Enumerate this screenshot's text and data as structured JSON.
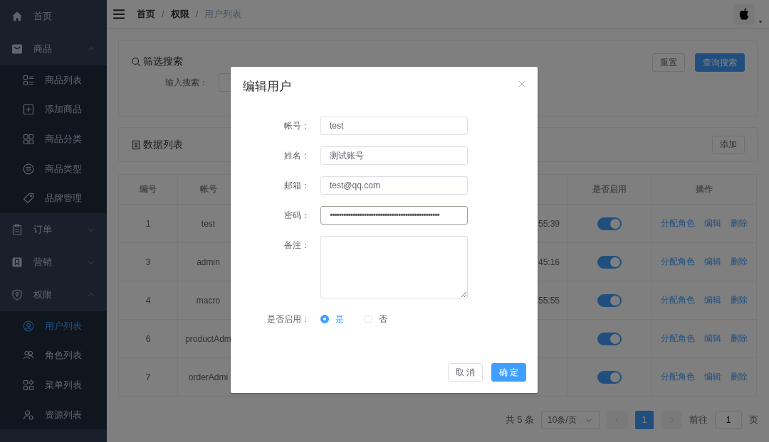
{
  "sidebar": {
    "groups": [
      {
        "label": "首页"
      },
      {
        "label": "商品",
        "expanded": true,
        "children": [
          {
            "label": "商品列表",
            "selected": false
          },
          {
            "label": "添加商品",
            "selected": false
          },
          {
            "label": "商品分类",
            "selected": false
          },
          {
            "label": "商品类型",
            "selected": false
          },
          {
            "label": "品牌管理",
            "selected": false
          }
        ]
      },
      {
        "label": "订单",
        "expanded": false
      },
      {
        "label": "营销",
        "expanded": false
      },
      {
        "label": "权限",
        "expanded": true,
        "children": [
          {
            "label": "用户列表",
            "selected": true
          },
          {
            "label": "角色列表",
            "selected": false
          },
          {
            "label": "菜单列表",
            "selected": false
          },
          {
            "label": "资源列表",
            "selected": false
          }
        ]
      }
    ]
  },
  "breadcrumb": [
    {
      "label": "首页",
      "kind": "link"
    },
    {
      "label": "/",
      "kind": "separator"
    },
    {
      "label": "权限",
      "kind": "link"
    },
    {
      "label": "/",
      "kind": "separator"
    },
    {
      "label": "用户列表",
      "kind": "current"
    }
  ],
  "search_card": {
    "title": "筛选搜索",
    "reset_button": "重置",
    "search_button": "查询搜索",
    "input_label": "输入搜索："
  },
  "list_card": {
    "title": "数据列表",
    "add_button": "添加"
  },
  "table": {
    "columns": [
      "编号",
      "帐号",
      "是否启用",
      "操作"
    ],
    "rows": [
      {
        "id": "1",
        "account": "test",
        "column_3": "55:39",
        "enabled": true,
        "actions": [
          "分配角色",
          "编辑",
          "删除"
        ]
      },
      {
        "id": "3",
        "account": "admin",
        "column_3": "45:16",
        "enabled": true,
        "actions": [
          "分配角色",
          "编辑",
          "删除"
        ]
      },
      {
        "id": "4",
        "account": "macro",
        "column_3": "55:55",
        "enabled": true,
        "actions": [
          "分配角色",
          "编辑",
          "删除"
        ]
      },
      {
        "id": "6",
        "account": "productAdm",
        "enabled": true,
        "actions": [
          "分配角色",
          "编辑",
          "删除"
        ]
      },
      {
        "id": "7",
        "account": "orderAdmi",
        "enabled": true,
        "actions": [
          "分配角色",
          "编辑",
          "删除"
        ]
      }
    ]
  },
  "pagination": {
    "total": "共 5 条",
    "page_size": "10条/页",
    "pages": [
      {
        "label": "1",
        "selected": true
      }
    ],
    "goto_label": "前往",
    "goto_value": "1",
    "goto_suffix": "页"
  },
  "dialog": {
    "title": "编辑用户",
    "fields": [
      {
        "label": "帐号：",
        "kind": "input",
        "value": "test"
      },
      {
        "label": "姓名：",
        "kind": "input",
        "value": "测试账号"
      },
      {
        "label": "邮箱：",
        "kind": "input",
        "value": "test@qq.com"
      },
      {
        "label": "密码：",
        "kind": "input",
        "value": "••••••••••••••••••••••••••••••••••••••••••••••••",
        "focused": true
      },
      {
        "label": "备注：",
        "kind": "textarea"
      },
      {
        "label": "是否启用：",
        "kind": "radio",
        "options": [
          {
            "label": "是",
            "selected": true
          },
          {
            "label": "否",
            "selected": false
          }
        ]
      }
    ],
    "cancel_button": "取 消",
    "confirm_button": "确 定"
  }
}
